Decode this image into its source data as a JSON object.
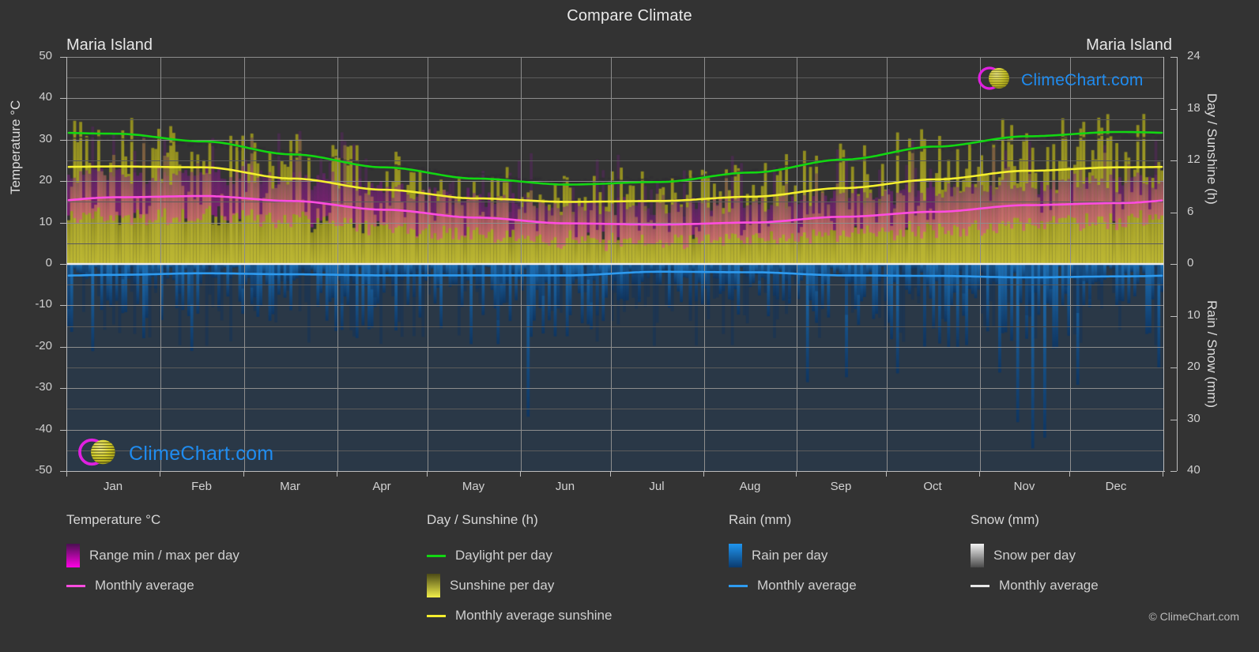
{
  "header": {
    "title": "Compare Climate",
    "location_left": "Maria Island",
    "location_right": "Maria Island"
  },
  "axes": {
    "left_label": "Temperature °C",
    "left_ticks": [
      "50",
      "40",
      "30",
      "20",
      "10",
      "0",
      "-10",
      "-20",
      "-30",
      "-40",
      "-50"
    ],
    "right_top_label": "Day / Sunshine (h)",
    "right_top_ticks": [
      "24",
      "18",
      "12",
      "6",
      "0"
    ],
    "right_bottom_label": "Rain / Snow (mm)",
    "right_bottom_ticks": [
      "0",
      "10",
      "20",
      "30",
      "40"
    ],
    "months": [
      "Jan",
      "Feb",
      "Mar",
      "Apr",
      "May",
      "Jun",
      "Jul",
      "Aug",
      "Sep",
      "Oct",
      "Nov",
      "Dec"
    ]
  },
  "logo": {
    "text": "ClimeChart.com",
    "ring_color": "#e020e0",
    "sphere_color": "#d8d22a",
    "text_color": "#1f8cf0"
  },
  "legend": {
    "columns": [
      {
        "heading": "Temperature °C",
        "items": [
          {
            "label": "Range min / max per day",
            "swatch": "gradient",
            "color_top": "#4a1050",
            "color_bottom": "#ff00e4"
          },
          {
            "label": "Monthly average",
            "swatch": "line",
            "color": "#ff4ce0"
          }
        ]
      },
      {
        "heading": "Day / Sunshine (h)",
        "items": [
          {
            "label": "Daylight per day",
            "swatch": "line",
            "color": "#12d712"
          },
          {
            "label": "Sunshine per day",
            "swatch": "gradient",
            "color_top": "#4b4a16",
            "color_bottom": "#f2ef4b"
          },
          {
            "label": "Monthly average sunshine",
            "swatch": "line",
            "color": "#f4ef2e"
          }
        ]
      },
      {
        "heading": "Rain (mm)",
        "items": [
          {
            "label": "Rain per day",
            "swatch": "gradient",
            "color_top": "#1f95ef",
            "color_bottom": "#0b3a6e"
          },
          {
            "label": "Monthly average",
            "swatch": "line",
            "color": "#2e9bf0"
          }
        ]
      },
      {
        "heading": "Snow (mm)",
        "items": [
          {
            "label": "Snow per day",
            "swatch": "gradient",
            "color_top": "#f2f2f2",
            "color_bottom": "#4a4a4a"
          },
          {
            "label": "Monthly average",
            "swatch": "line",
            "color": "#e8e8e8"
          }
        ]
      }
    ],
    "copyright": "© ClimeChart.com"
  },
  "chart_data": {
    "type": "line",
    "title": "Compare Climate",
    "subtitle": "Maria Island",
    "xlabel": "",
    "ylabel": "Temperature °C",
    "ylim": [
      -50,
      50
    ],
    "y2_top_label": "Day / Sunshine (h)",
    "y2_top_lim": [
      0,
      24
    ],
    "y2_bottom_label": "Rain / Snow (mm)",
    "y2_bottom_lim": [
      0,
      40
    ],
    "grid": true,
    "legend_position": "below",
    "categories": [
      "Jan",
      "Feb",
      "Mar",
      "Apr",
      "May",
      "Jun",
      "Jul",
      "Aug",
      "Sep",
      "Oct",
      "Nov",
      "Dec"
    ],
    "series": [
      {
        "name": "Daylight per day",
        "unit": "h",
        "color": "#12d712",
        "axis": "right_top",
        "values": [
          15.1,
          14.2,
          12.7,
          11.2,
          9.9,
          9.2,
          9.5,
          10.6,
          12.1,
          13.6,
          14.8,
          15.3
        ]
      },
      {
        "name": "Monthly average sunshine",
        "unit": "h",
        "color": "#f4ef2e",
        "axis": "right_top",
        "values": [
          11.3,
          11.2,
          9.9,
          8.6,
          7.6,
          7.2,
          7.3,
          7.8,
          8.8,
          9.8,
          10.8,
          11.2
        ]
      },
      {
        "name": "Monthly average temperature",
        "unit": "°C",
        "color": "#ff4ce0",
        "axis": "left",
        "values": [
          16.1,
          16.4,
          15.2,
          13.1,
          11.2,
          9.8,
          9.5,
          10.0,
          11.4,
          12.6,
          14.2,
          14.7
        ]
      },
      {
        "name": "Monthly average rain",
        "unit": "mm",
        "color": "#2e9bf0",
        "axis": "right_bottom",
        "values": [
          2.1,
          1.8,
          2.0,
          2.2,
          2.2,
          2.2,
          1.5,
          1.6,
          2.2,
          2.3,
          2.6,
          2.4
        ]
      },
      {
        "name": "Monthly average snow",
        "unit": "mm",
        "color": "#e8e8e8",
        "axis": "right_bottom",
        "values": [
          0,
          0,
          0,
          0,
          0,
          0,
          0,
          0,
          0,
          0,
          0,
          0
        ]
      }
    ],
    "bands": [
      {
        "name": "Range min / max per day",
        "unit": "°C",
        "color": "#ff00e4",
        "axis": "left",
        "min": [
          12.5,
          12.8,
          11.8,
          9.8,
          8.0,
          6.8,
          6.5,
          7.0,
          8.2,
          9.3,
          10.8,
          11.4
        ],
        "max": [
          20.0,
          20.3,
          18.8,
          16.4,
          14.2,
          12.6,
          12.4,
          13.0,
          14.5,
          16.0,
          17.7,
          18.3
        ]
      },
      {
        "name": "Sunshine per day",
        "unit": "h",
        "color": "#d8d22a",
        "axis": "right_top",
        "min": [
          0,
          0,
          0,
          0,
          0,
          0,
          0,
          0,
          0,
          0,
          0,
          0
        ],
        "max": [
          13.9,
          13.3,
          12.2,
          10.7,
          9.5,
          8.9,
          9.1,
          10.0,
          11.4,
          12.8,
          13.7,
          14.1
        ]
      },
      {
        "name": "Rain per day",
        "unit": "mm",
        "color": "#1f95ef",
        "axis": "right_bottom",
        "min": [
          0,
          0,
          0,
          0,
          0,
          0,
          0,
          0,
          0,
          0,
          0,
          0
        ],
        "max": [
          18,
          16,
          20,
          22,
          24,
          22,
          14,
          15,
          20,
          24,
          26,
          22
        ]
      }
    ]
  }
}
